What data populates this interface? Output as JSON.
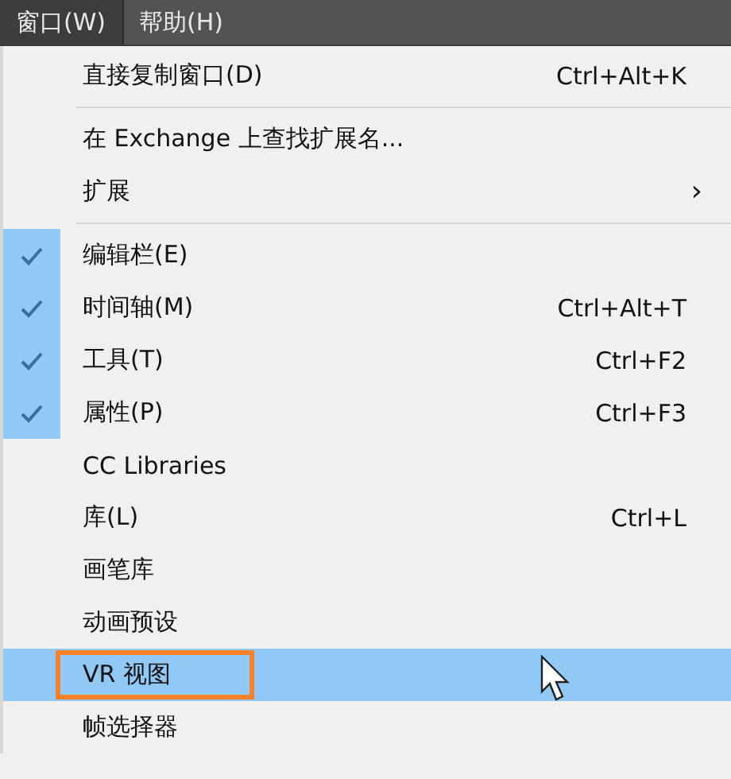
{
  "menubar": [
    {
      "label": "窗口(W)",
      "selected": true
    },
    {
      "label": "帮助(H)",
      "selected": false
    }
  ],
  "menu": [
    {
      "kind": "item",
      "label": "直接复制窗口(D)",
      "shortcut": "Ctrl+Alt+K",
      "checked": false,
      "selected": false,
      "annotated": false
    },
    {
      "kind": "separator"
    },
    {
      "kind": "item",
      "label": "在 Exchange 上查找扩展名...",
      "checked": false,
      "selected": false,
      "annotated": false
    },
    {
      "kind": "item",
      "label": "扩展",
      "submenu_arrow": "›",
      "checked": false,
      "selected": false,
      "annotated": false
    },
    {
      "kind": "separator"
    },
    {
      "kind": "item",
      "label": "编辑栏(E)",
      "checked": true,
      "selected": false,
      "annotated": false
    },
    {
      "kind": "item",
      "label": "时间轴(M)",
      "shortcut": "Ctrl+Alt+T",
      "checked": true,
      "selected": false,
      "annotated": false
    },
    {
      "kind": "item",
      "label": "工具(T)",
      "shortcut": "Ctrl+F2",
      "checked": true,
      "selected": false,
      "annotated": false
    },
    {
      "kind": "item",
      "label": "属性(P)",
      "shortcut": "Ctrl+F3",
      "checked": true,
      "selected": false,
      "annotated": false
    },
    {
      "kind": "item",
      "label": "CC Libraries",
      "checked": false,
      "selected": false,
      "annotated": false
    },
    {
      "kind": "item",
      "label": "库(L)",
      "shortcut": "Ctrl+L",
      "checked": false,
      "selected": false,
      "annotated": false
    },
    {
      "kind": "item",
      "label": "画笔库",
      "checked": false,
      "selected": false,
      "annotated": false
    },
    {
      "kind": "item",
      "label": "动画预设",
      "checked": false,
      "selected": false,
      "annotated": false
    },
    {
      "kind": "item",
      "label": "VR 视图",
      "checked": false,
      "selected": true,
      "annotated": true
    },
    {
      "kind": "item",
      "label": "帧选择器",
      "checked": false,
      "selected": false,
      "annotated": false
    }
  ]
}
